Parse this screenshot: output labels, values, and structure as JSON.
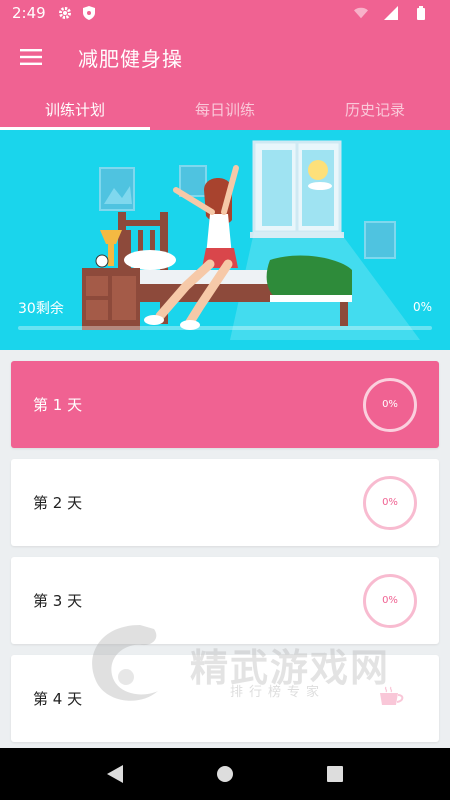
{
  "status_bar": {
    "time": "2:49"
  },
  "app_bar": {
    "title": "减肥健身操"
  },
  "tabs": [
    {
      "label": "训练计划",
      "active": true
    },
    {
      "label": "每日训练",
      "active": false
    },
    {
      "label": "历史记录",
      "active": false
    }
  ],
  "hero": {
    "remaining_text": "30剩余",
    "progress_text": "0%",
    "progress": 0
  },
  "days": [
    {
      "label": "第 1 天",
      "progress": "0%",
      "active": true
    },
    {
      "label": "第 2 天",
      "progress": "0%",
      "active": false
    },
    {
      "label": "第 3 天",
      "progress": "0%",
      "active": false
    },
    {
      "label": "第 4 天",
      "progress": "",
      "active": false
    }
  ],
  "watermark": {
    "title": "精武游戏网",
    "subtitle": "排行榜专家"
  },
  "colors": {
    "primary": "#f06292",
    "hero_bg": "#1ad5ec",
    "ring": "#f8bbd0"
  }
}
